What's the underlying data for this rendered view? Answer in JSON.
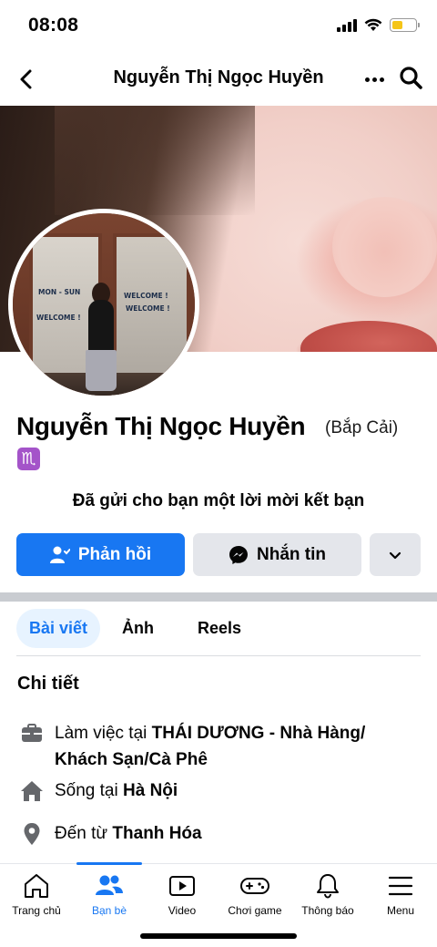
{
  "status_bar": {
    "time": "08:08",
    "icons": [
      "signal-icon",
      "wifi-icon",
      "battery-icon"
    ],
    "battery_color": "#f5c518"
  },
  "header": {
    "title": "Nguyễn Thị Ngọc Huyền",
    "back_icon": "chevron-left-icon",
    "more_icon": "more-horizontal-icon",
    "search_icon": "search-icon"
  },
  "cover": {
    "avatar_signs": [
      "MON - SUN",
      "WELCOME !",
      "WELCOME !",
      "WELCOME !"
    ]
  },
  "profile": {
    "name": "Nguyễn Thị Ngọc Huyền",
    "alternate_name": "(Bắp Cải)",
    "zodiac_symbol": "♏",
    "zodiac_color": "#a454c9",
    "friend_request_text": "Đã gửi cho bạn một lời mời kết bạn"
  },
  "actions": {
    "reply_label": "Phản hồi",
    "message_label": "Nhắn tin",
    "reply_color": "#1877f2",
    "secondary_color": "#e4e6eb"
  },
  "tabs": {
    "posts": "Bài viết",
    "photos": "Ảnh",
    "reels": "Reels",
    "active": "posts"
  },
  "details": {
    "title": "Chi tiết",
    "work_prefix": "Làm việc tại ",
    "work_place": "THÁI DƯƠNG - Nhà Hàng/ Khách Sạn/Cà Phê",
    "lives_prefix": "Sống tại ",
    "lives_place": "Hà Nội",
    "from_prefix": "Đến từ ",
    "from_place": "Thanh Hóa"
  },
  "bottom_nav": {
    "items": [
      {
        "label": "Trang chủ",
        "icon": "home-icon"
      },
      {
        "label": "Bạn bè",
        "icon": "friends-icon"
      },
      {
        "label": "Video",
        "icon": "video-icon"
      },
      {
        "label": "Chơi game",
        "icon": "gaming-icon"
      },
      {
        "label": "Thông báo",
        "icon": "bell-icon"
      },
      {
        "label": "Menu",
        "icon": "menu-icon"
      }
    ],
    "active": "Bạn bè",
    "accent_color": "#1877f2"
  }
}
